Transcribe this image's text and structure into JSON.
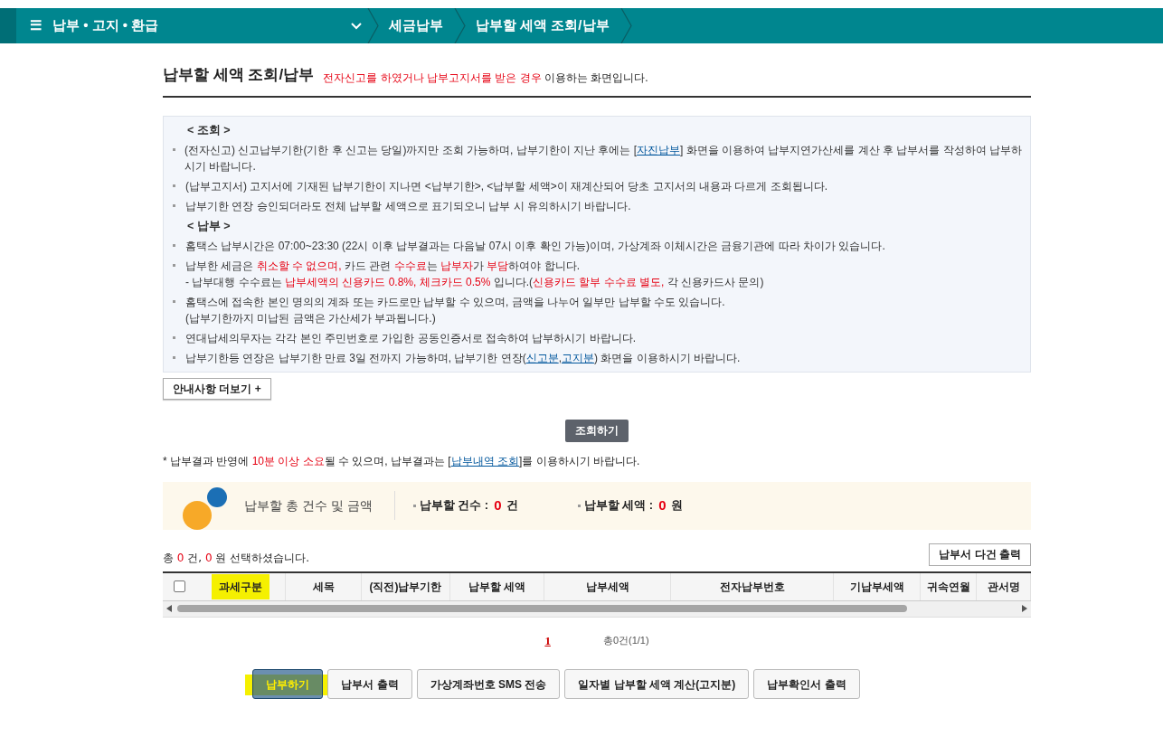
{
  "topbar": {
    "menu_icon": "☰",
    "menu": "납부 • 고지 • 환급",
    "breadcrumbs": [
      "세금납부",
      "납부할 세액 조회/납부"
    ]
  },
  "heading": {
    "title": "납부할 세액 조회/납부",
    "description": [
      {
        "kind": "red",
        "text": "전자신고를 하였거나 납부고지서를 받은 경우"
      },
      {
        "kind": "plain",
        "text": " 이용하는 화면입니다."
      }
    ]
  },
  "notices": [
    {
      "title": "< 조회 >",
      "items": [
        {
          "lines": [
            [
              {
                "kind": "plain",
                "text": "(전자신고) 신고납부기한(기한 후 신고는 당일)까지만 조회 가능하며, 납부기한이 지난 후에는 ["
              },
              {
                "kind": "link",
                "text": "자진납부"
              },
              {
                "kind": "plain",
                "text": "] 화면을 이용하여 납부지연가산세를 계산 후 납부서를 작성하여 납부하시기 바랍니다."
              }
            ]
          ]
        },
        {
          "lines": [
            [
              {
                "kind": "plain",
                "text": "(납부고지서) 고지서에 기재된 납부기한이 지나면 <납부기한>, <납부할 세액>이 재계산되어 당초 고지서의 내용과 다르게 조회됩니다."
              }
            ]
          ]
        },
        {
          "lines": [
            [
              {
                "kind": "plain",
                "text": "납부기한 연장 승인되더라도 전체 납부할 세액으로 표기되오니 납부 시 유의하시기 바랍니다."
              }
            ]
          ]
        }
      ]
    },
    {
      "title": "< 납부 >",
      "items": [
        {
          "lines": [
            [
              {
                "kind": "plain",
                "text": "홈택스 납부시간은 07:00~23:30 (22시 이후 납부결과는 다음날 07시 이후 확인 가능)이며, 가상계좌 이체시간은 금융기관에 따라 차이가 있습니다."
              }
            ]
          ]
        },
        {
          "lines": [
            [
              {
                "kind": "plain",
                "text": "납부한 세금은 "
              },
              {
                "kind": "red",
                "text": "취소할 수 없으며,"
              },
              {
                "kind": "plain",
                "text": " 카드 관련 "
              },
              {
                "kind": "red",
                "text": "수수료"
              },
              {
                "kind": "plain",
                "text": "는 "
              },
              {
                "kind": "red",
                "text": "납부자"
              },
              {
                "kind": "plain",
                "text": "가 "
              },
              {
                "kind": "red",
                "text": "부담"
              },
              {
                "kind": "plain",
                "text": "하여야 합니다."
              }
            ],
            [
              {
                "kind": "plain",
                "text": "- 납부대행 수수료는 "
              },
              {
                "kind": "red",
                "text": "납부세액의 신용카드 0.8%, 체크카드 0.5%"
              },
              {
                "kind": "plain",
                "text": " 입니다.("
              },
              {
                "kind": "red",
                "text": "신용카드 할부 수수료 별도,"
              },
              {
                "kind": "plain",
                "text": " 각 신용카드사 문의)"
              }
            ]
          ]
        },
        {
          "lines": [
            [
              {
                "kind": "plain",
                "text": "홈택스에 접속한 본인 명의의 계좌 또는 카드로만 납부할 수 있으며, 금액을 나누어 일부만 납부할 수도 있습니다."
              }
            ],
            [
              {
                "kind": "plain",
                "text": "(납부기한까지 미납된 금액은 가산세가 부과됩니다.)"
              }
            ]
          ]
        },
        {
          "lines": [
            [
              {
                "kind": "plain",
                "text": "연대납세의무자는 각각 본인 주민번호로 가입한 공동인증서로 접속하여 납부하시기 바랍니다."
              }
            ]
          ]
        },
        {
          "lines": [
            [
              {
                "kind": "plain",
                "text": "납부기한등 연장은 납부기한 만료 3일 전까지 가능하며, 납부기한 연장("
              },
              {
                "kind": "link",
                "text": "신고분"
              },
              {
                "kind": "plain",
                "text": ","
              },
              {
                "kind": "link",
                "text": "고지분"
              },
              {
                "kind": "plain",
                "text": ") 화면을 이용하시기 바랍니다."
              }
            ]
          ]
        }
      ]
    }
  ],
  "more_button": "안내사항 더보기 +",
  "search_button": "조회하기",
  "result_note": [
    {
      "kind": "plain",
      "text": "* 납부결과 반영에 "
    },
    {
      "kind": "red",
      "text": "10분 이상 소요"
    },
    {
      "kind": "plain",
      "text": "될 수 있으며, 납부결과는 ["
    },
    {
      "kind": "link",
      "text": "납부내역 조회"
    },
    {
      "kind": "plain",
      "text": "]를 이용하시기 바랍니다."
    }
  ],
  "summary": {
    "title": "납부할 총 건수 및 금액",
    "items": [
      {
        "label": "납부할 건수 :",
        "value": "0",
        "unit": "건"
      },
      {
        "label": "납부할 세액 :",
        "value": "0",
        "unit": "원"
      }
    ]
  },
  "selection": [
    {
      "kind": "plain",
      "text": "총 "
    },
    {
      "kind": "red",
      "text": "0"
    },
    {
      "kind": "plain",
      "text": " 건, "
    },
    {
      "kind": "red",
      "text": "0"
    },
    {
      "kind": "plain",
      "text": " 원 선택하셨습니다."
    }
  ],
  "print_multi_button": "납부서 다건 출력",
  "table": {
    "select_all_checked": false,
    "columns": [
      {
        "label": "과세구분",
        "highlighted": true
      },
      {
        "label": "세목",
        "highlighted": false
      },
      {
        "label": "(직전)납부기한",
        "highlighted": false
      },
      {
        "label": "납부할 세액",
        "highlighted": false
      },
      {
        "label": "납부세액",
        "highlighted": false
      },
      {
        "label": "전자납부번호",
        "highlighted": false
      },
      {
        "label": "기납부세액",
        "highlighted": false
      },
      {
        "label": "귀속연월",
        "highlighted": false
      },
      {
        "label": "관서명",
        "highlighted": false
      }
    ]
  },
  "pagination": {
    "pages": [
      {
        "label": "1",
        "selected": true
      }
    ],
    "summary": "총0건(1/1)"
  },
  "actions": [
    {
      "label": "납부하기",
      "kind": "primary",
      "highlighted": true
    },
    {
      "label": "납부서 출력",
      "kind": "default",
      "highlighted": false
    },
    {
      "label": "가상계좌번호 SMS 전송",
      "kind": "default",
      "highlighted": false
    },
    {
      "label": "일자별 납부할 세액 계산(고지분)",
      "kind": "default",
      "highlighted": false
    },
    {
      "label": "납부확인서 출력",
      "kind": "default",
      "highlighted": false
    }
  ]
}
